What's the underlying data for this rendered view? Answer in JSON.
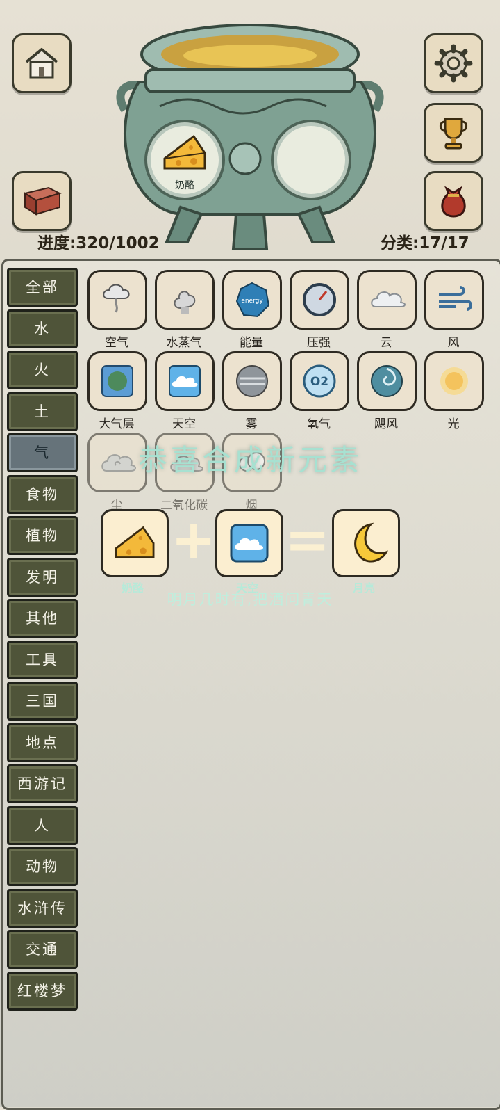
{
  "header": {
    "progress_label": "进度:320/1002",
    "category_label": "分类:17/17",
    "buttons": [
      "home-icon",
      "gear-icon",
      "trophy-icon",
      "book-icon",
      "treasure-bag-icon"
    ]
  },
  "cauldron": {
    "slot_left_label": "奶酪",
    "slot_left_icon": "cheese-icon",
    "slot_right_label": ""
  },
  "tabs": [
    "全部",
    "水",
    "火",
    "土",
    "气",
    "食物",
    "植物",
    "发明",
    "其他",
    "工具",
    "三国",
    "地点",
    "西游记",
    "人",
    "动物",
    "水浒传",
    "交通",
    "红楼梦"
  ],
  "active_tab": "气",
  "elements": [
    {
      "name": "空气",
      "icon": "air-icon"
    },
    {
      "name": "水蒸气",
      "icon": "steam-icon"
    },
    {
      "name": "能量",
      "icon": "energy-icon",
      "badge": "energy"
    },
    {
      "name": "压强",
      "icon": "pressure-gauge-icon"
    },
    {
      "name": "云",
      "icon": "cloud-icon"
    },
    {
      "name": "风",
      "icon": "wind-icon"
    },
    {
      "name": "大气层",
      "icon": "atmosphere-icon"
    },
    {
      "name": "天空",
      "icon": "sky-icon"
    },
    {
      "name": "雾",
      "icon": "fog-icon"
    },
    {
      "name": "氧气",
      "icon": "oxygen-icon",
      "badge": "O2"
    },
    {
      "name": "飓风",
      "icon": "hurricane-icon"
    },
    {
      "name": "光",
      "icon": "light-icon"
    },
    {
      "name": "尘",
      "icon": "dust-icon"
    },
    {
      "name": "二氧化碳",
      "icon": "co2-icon"
    },
    {
      "name": "烟",
      "icon": "smoke-icon"
    }
  ],
  "overlay": {
    "title": "恭喜合成新元素",
    "input1": "奶酪",
    "input2": "天空",
    "result": "月亮",
    "plus": "+",
    "equals": "=",
    "poem": "明月几时有,把酒问青天"
  }
}
